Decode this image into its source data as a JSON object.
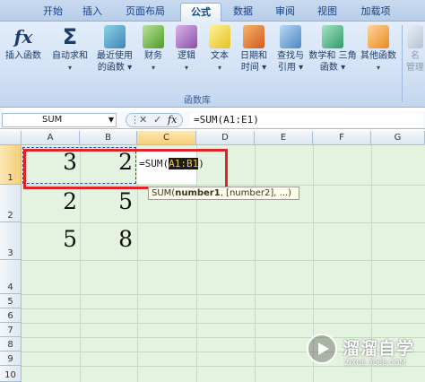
{
  "tabs": [
    {
      "label": "开始",
      "active": false
    },
    {
      "label": "插入",
      "active": false
    },
    {
      "label": "页面布局",
      "active": false
    },
    {
      "label": "公式",
      "active": true
    },
    {
      "label": "数据",
      "active": false
    },
    {
      "label": "审阅",
      "active": false
    },
    {
      "label": "视图",
      "active": false
    },
    {
      "label": "加载项",
      "active": false
    }
  ],
  "ribbon": {
    "buttons": [
      {
        "line1": "插入函数",
        "line2": "",
        "icon": "fx-icon",
        "dropdown": false
      },
      {
        "line1": "自动求和",
        "line2": "▾",
        "icon": "sigma-icon",
        "dropdown": true
      },
      {
        "line1": "最近使用",
        "line2": "的函数 ▾",
        "icon": "recent-book-icon",
        "dropdown": true
      },
      {
        "line1": "财务",
        "line2": "▾",
        "icon": "finance-book-icon",
        "dropdown": true
      },
      {
        "line1": "逻辑",
        "line2": "▾",
        "icon": "logic-book-icon",
        "dropdown": true
      },
      {
        "line1": "文本",
        "line2": "▾",
        "icon": "text-book-icon",
        "dropdown": true
      },
      {
        "line1": "日期和",
        "line2": "时间 ▾",
        "icon": "date-book-icon",
        "dropdown": true
      },
      {
        "line1": "查找与",
        "line2": "引用 ▾",
        "icon": "lookup-book-icon",
        "dropdown": true
      },
      {
        "line1": "数学和",
        "line2": "三角函数 ▾",
        "icon": "math-book-icon",
        "dropdown": true
      },
      {
        "line1": "其他函数",
        "line2": "▾",
        "icon": "more-book-icon",
        "dropdown": true
      },
      {
        "line1": "名",
        "line2": "管理",
        "icon": "name-manager-icon",
        "dropdown": false
      }
    ],
    "group_label": "函数库"
  },
  "formula_bar": {
    "name_box": "SUM",
    "cancel": "✕",
    "enter": "✓",
    "fx": "fx",
    "formula": "=SUM(A1:E1)"
  },
  "grid": {
    "columns": [
      "A",
      "B",
      "C",
      "D",
      "E",
      "F",
      "G"
    ],
    "selected_column": "C",
    "rows": [
      "1",
      "2",
      "3",
      "4",
      "5",
      "6",
      "7",
      "8",
      "9",
      "10"
    ],
    "selected_row": "1",
    "cells": {
      "A1": "3",
      "B1": "2",
      "A2": "2",
      "B2": "5",
      "A3": "5",
      "B3": "8"
    },
    "editing_cell": {
      "prefix": "=SUM(",
      "range": "A1:B1",
      "suffix": ")"
    },
    "tooltip": {
      "func": "SUM(",
      "arg1": "number1",
      "rest": ", [number2], ...)"
    }
  },
  "watermark": {
    "name": "溜溜自学",
    "url": "ZIXUE.3066.COM"
  },
  "colors": {
    "accent_red": "#e0232b",
    "grid_bg": "#e4f3df",
    "highlight": "#f7c43a"
  }
}
